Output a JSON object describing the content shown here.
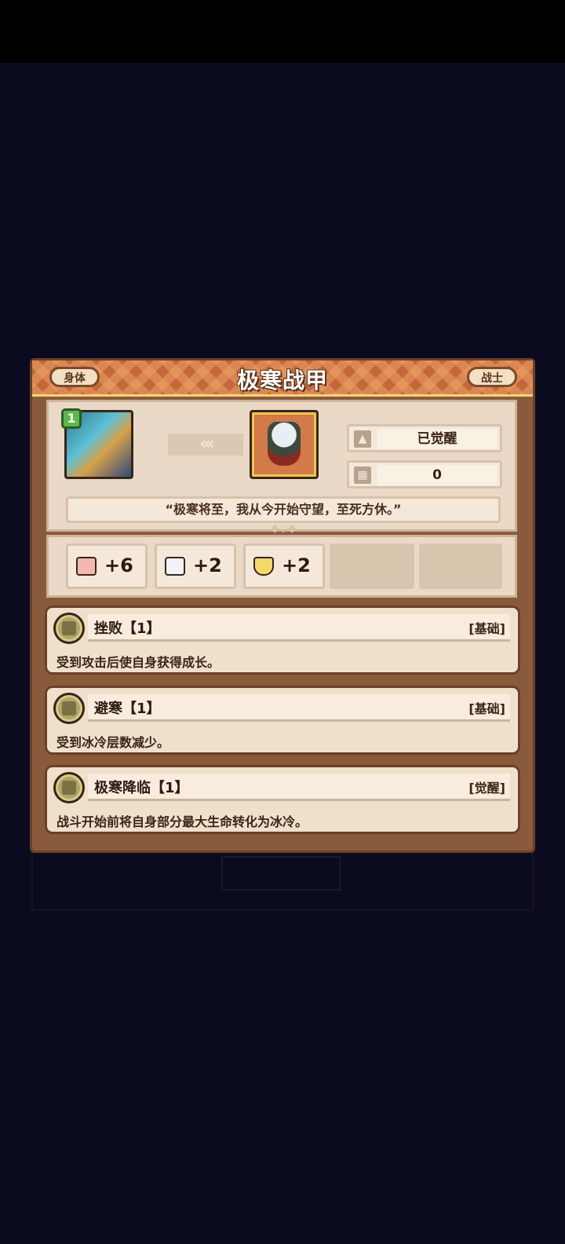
{
  "header": {
    "title": "极寒战甲",
    "left_tag": "身体",
    "right_tag": "战士"
  },
  "hero": {
    "level": "1"
  },
  "item_info": {
    "awaken_status": "已觉醒",
    "count": "0",
    "quote": "“极寒将至，我从今开始守望，至死方休。”"
  },
  "stats": [
    {
      "icon": "fist-icon",
      "value": "+6"
    },
    {
      "icon": "book-icon",
      "value": "+2"
    },
    {
      "icon": "shield-icon",
      "value": "+2"
    }
  ],
  "skills": [
    {
      "name": "挫败【1】",
      "type": "[基础]",
      "description": "受到攻击后使自身获得成长。"
    },
    {
      "name": "避寒【1】",
      "type": "[基础]",
      "description": "受到冰冷层数减少。"
    },
    {
      "name": "极寒降临【1】",
      "type": "[觉醒]",
      "description": "战斗开始前将自身部分最大生命转化为冰冷。"
    }
  ],
  "colors": {
    "background": "#0b0b20",
    "header": "#c4683c",
    "panel": "#ead9c6",
    "frame": "#8a5a3c"
  }
}
